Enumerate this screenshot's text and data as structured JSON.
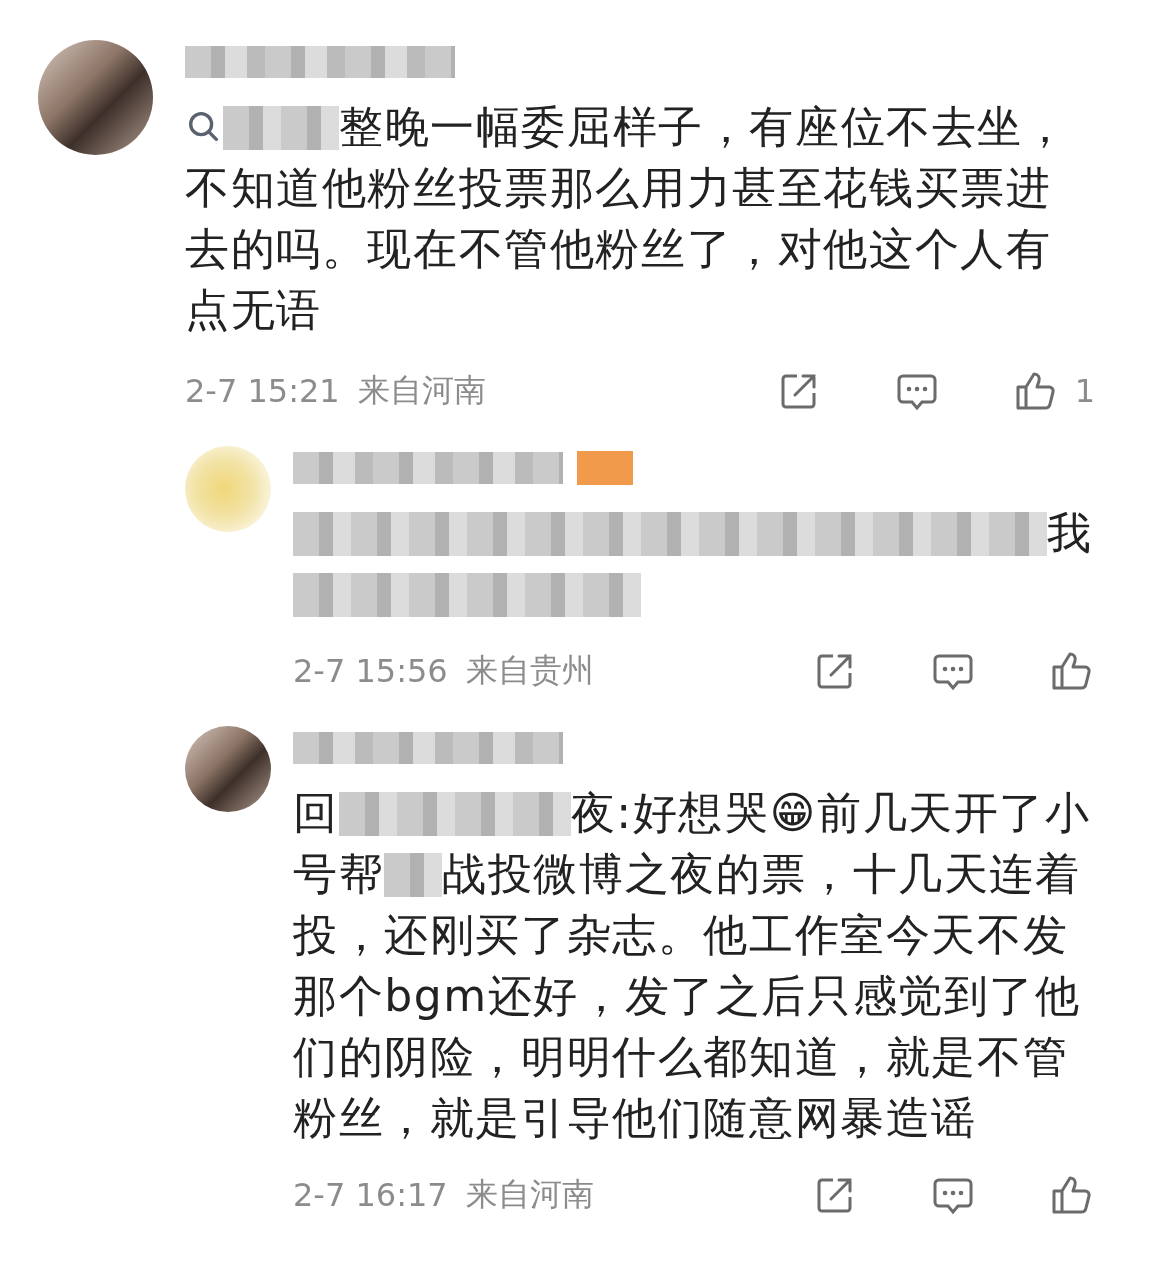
{
  "comments": [
    {
      "kind": "comment",
      "search_icon": true,
      "body": [
        {
          "kind": "redacted"
        },
        {
          "kind": "redacted"
        },
        {
          "kind": "text",
          "text": "整晚一幅委屈样子，有座位不去坐，不知道他粉丝投票那么用力甚至花钱买票进去的吗。现在不管他粉丝了，对他这个人有点无语"
        }
      ],
      "time": "2-7 15:21",
      "location": "来自河南",
      "likes": "1"
    },
    {
      "kind": "reply",
      "badge": true,
      "body": [
        {
          "kind": "redacted"
        },
        {
          "kind": "redacted"
        },
        {
          "kind": "redacted"
        },
        {
          "kind": "redacted"
        },
        {
          "kind": "redacted"
        },
        {
          "kind": "redacted"
        },
        {
          "kind": "redacted"
        },
        {
          "kind": "redacted"
        },
        {
          "kind": "redacted"
        },
        {
          "kind": "redacted"
        },
        {
          "kind": "redacted"
        },
        {
          "kind": "redacted"
        },
        {
          "kind": "redacted"
        },
        {
          "kind": "text",
          "text": "我"
        },
        {
          "kind": "redacted"
        },
        {
          "kind": "redacted"
        },
        {
          "kind": "redacted"
        },
        {
          "kind": "redacted"
        },
        {
          "kind": "redacted"
        },
        {
          "kind": "redacted"
        }
      ],
      "time": "2-7 15:56",
      "location": "来自贵州"
    },
    {
      "kind": "reply",
      "body": [
        {
          "kind": "text",
          "text": "回"
        },
        {
          "kind": "redacted"
        },
        {
          "kind": "redacted"
        },
        {
          "kind": "redacted"
        },
        {
          "kind": "redacted"
        },
        {
          "kind": "text",
          "text": "夜:好想哭😁前几天开了小号帮"
        },
        {
          "kind": "redacted"
        },
        {
          "kind": "text",
          "text": "战投微博之夜的票，十几天连着投，还刚买了杂志。他工作室今天不发那个bgm还好，发了之后只感觉到了他们的阴险，明明什么都知道，就是不管粉丝，就是引导他们随意网暴造谣"
        }
      ],
      "time": "2-7 16:17",
      "location": "来自河南"
    }
  ]
}
